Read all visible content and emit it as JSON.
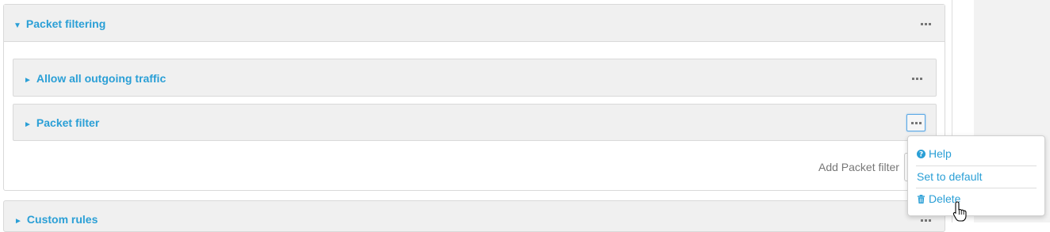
{
  "panel": {
    "title": "Packet filtering",
    "expand_glyph": "▼",
    "items": [
      {
        "title": "Allow all outgoing traffic",
        "collapse_glyph": "►"
      },
      {
        "title": "Packet filter",
        "collapse_glyph": "►"
      }
    ],
    "add_label": "Add Packet filter"
  },
  "next_panel": {
    "title": "Custom rules",
    "collapse_glyph": "►"
  },
  "context_menu": {
    "help": "Help",
    "set_default": "Set to default",
    "delete": "Delete"
  },
  "icons": {
    "panel_menu": "more-dots-icon",
    "help": "question-circle-icon",
    "delete": "trash-icon",
    "cursor": "hand-pointer-icon"
  },
  "colors": {
    "link": "#2a9fd6",
    "header_bg": "#f0f0f0",
    "focus_border": "#5aa8e6"
  }
}
